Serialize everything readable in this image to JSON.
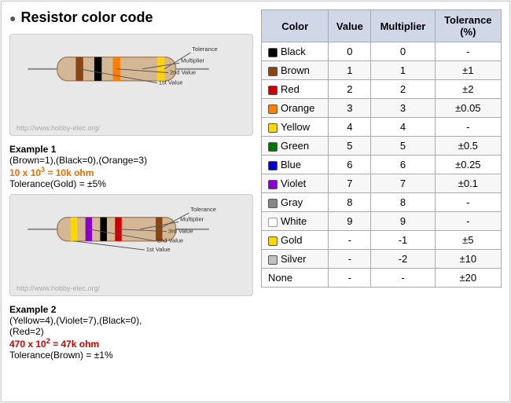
{
  "page": {
    "title": "Resistor color code",
    "title_icon": "●"
  },
  "table": {
    "headers": [
      "Color",
      "Value",
      "Multiplier",
      "Tolerance (%)"
    ],
    "rows": [
      {
        "color": "Black",
        "swatch": "#000000",
        "value": "0",
        "multiplier": "0",
        "tolerance": "-"
      },
      {
        "color": "Brown",
        "swatch": "#8B4513",
        "value": "1",
        "multiplier": "1",
        "tolerance": "±1"
      },
      {
        "color": "Red",
        "swatch": "#CC0000",
        "value": "2",
        "multiplier": "2",
        "tolerance": "±2"
      },
      {
        "color": "Orange",
        "swatch": "#FF8000",
        "value": "3",
        "multiplier": "3",
        "tolerance": "±0.05"
      },
      {
        "color": "Yellow",
        "swatch": "#FFD700",
        "value": "4",
        "multiplier": "4",
        "tolerance": "-"
      },
      {
        "color": "Green",
        "swatch": "#007700",
        "value": "5",
        "multiplier": "5",
        "tolerance": "±0.5"
      },
      {
        "color": "Blue",
        "swatch": "#0000CC",
        "value": "6",
        "multiplier": "6",
        "tolerance": "±0.25"
      },
      {
        "color": "Violet",
        "swatch": "#8B00CC",
        "value": "7",
        "multiplier": "7",
        "tolerance": "±0.1"
      },
      {
        "color": "Gray",
        "swatch": "#888888",
        "value": "8",
        "multiplier": "8",
        "tolerance": "-"
      },
      {
        "color": "White",
        "swatch": "#FFFFFF",
        "value": "9",
        "multiplier": "9",
        "tolerance": "-"
      },
      {
        "color": "Gold",
        "swatch": "#FFD700",
        "value": "-",
        "multiplier": "-1",
        "tolerance": "±5"
      },
      {
        "color": "Silver",
        "swatch": "#C0C0C0",
        "value": "-",
        "multiplier": "-2",
        "tolerance": "±10"
      },
      {
        "color": "None",
        "swatch": null,
        "value": "-",
        "multiplier": "-",
        "tolerance": "±20"
      }
    ]
  },
  "example1": {
    "title": "Example 1",
    "formula": "(Brown=1),(Black=0),(Orange=3)",
    "calc_prefix": "10 x 10",
    "calc_exp": "3",
    "calc_suffix": " = 10k ohm",
    "tolerance": "Tolerance(Gold) = ±5%",
    "url": "http://www.hobby-elec.org/"
  },
  "example2": {
    "title": "Example 2",
    "formula": "(Yellow=4),(Violet=7),(Black=0),",
    "formula2": "(Red=2)",
    "calc_prefix": "470 x 10",
    "calc_exp": "2",
    "calc_suffix": " = 47k ohm",
    "tolerance": "Tolerance(Brown) = ±1%",
    "url": "http://www.hobby-elec.org/"
  }
}
